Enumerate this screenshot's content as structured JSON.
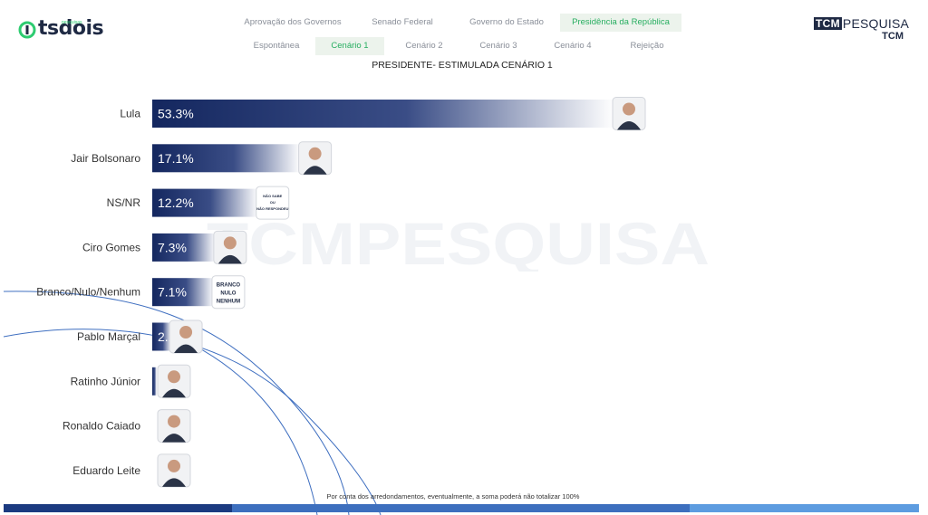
{
  "header": {
    "logo_text": "tsdois",
    "logo_sub": "pesquisas",
    "brand_box": "TCM",
    "brand_word": "PESQUISA",
    "brand_sub": "TCM"
  },
  "tabs_top": [
    {
      "label": "Aprovação dos Governos",
      "active": false
    },
    {
      "label": "Senado Federal",
      "active": false
    },
    {
      "label": "Governo do Estado",
      "active": false
    },
    {
      "label": "Presidência da República",
      "active": true
    }
  ],
  "tabs_sub": [
    {
      "label": "Espontânea",
      "active": false
    },
    {
      "label": "Cenário 1",
      "active": true
    },
    {
      "label": "Cenário 2",
      "active": false
    },
    {
      "label": "Cenário 3",
      "active": false
    },
    {
      "label": "Cenário 4",
      "active": false
    },
    {
      "label": "Rejeição",
      "active": false
    }
  ],
  "watermark": "TCMPESQUISA",
  "footnote": "Por conta dos arredondamentos, eventualmente, a soma poderá não totalizar 100%",
  "colors": {
    "bar_dark": "#14275f",
    "bar_light": "#ffffff",
    "active_tab": "#27ae60",
    "brand_navy": "#1f2a44"
  },
  "chart_data": {
    "type": "bar",
    "orientation": "horizontal",
    "title": "PRESIDENTE- ESTIMULADA CENÁRIO 1",
    "categories": [
      "Lula",
      "Jair Bolsonaro",
      "NS/NR",
      "Ciro Gomes",
      "Branco/Nulo/Nenhum",
      "Pablo Marçal",
      "Ratinho Júnior",
      "Ronaldo Caiado",
      "Eduardo Leite"
    ],
    "values": [
      53.3,
      17.1,
      12.2,
      7.3,
      7.1,
      2.2,
      0.5,
      0,
      0
    ],
    "data_labels": [
      "53.3%",
      "17.1%",
      "12.2%",
      "7.3%",
      "7.1%",
      "2.2",
      "",
      "",
      ""
    ],
    "badges": [
      {
        "type": "photo",
        "icon": "person-icon"
      },
      {
        "type": "photo",
        "icon": "person-icon"
      },
      {
        "type": "text",
        "lines": [
          "NÃO SABE",
          "OU",
          "NÃO RESPONDEU"
        ]
      },
      {
        "type": "photo",
        "icon": "person-icon"
      },
      {
        "type": "text",
        "lines": [
          "BRANCO",
          "NULO",
          "NENHUM"
        ]
      },
      {
        "type": "photo",
        "icon": "person-icon"
      },
      {
        "type": "photo",
        "icon": "person-icon"
      },
      {
        "type": "photo",
        "icon": "person-icon"
      },
      {
        "type": "photo",
        "icon": "person-icon"
      }
    ],
    "xlim": [
      0,
      53.3
    ],
    "grid": false,
    "legend": "none"
  }
}
